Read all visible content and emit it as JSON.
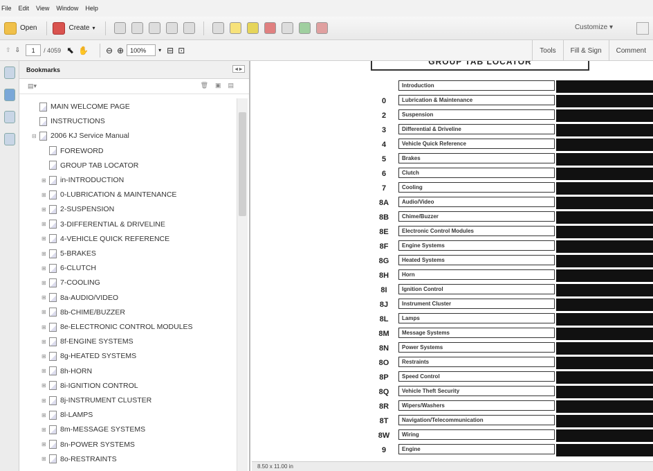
{
  "menu": [
    "File",
    "Edit",
    "View",
    "Window",
    "Help"
  ],
  "toolbar": {
    "open_label": "Open",
    "create_label": "Create",
    "customize_label": "Customize"
  },
  "nav": {
    "page_current": "1",
    "page_total": "/ 4059",
    "zoom": "100%"
  },
  "tabs": [
    "Tools",
    "Fill & Sign",
    "Comment"
  ],
  "bookmarks": {
    "title": "Bookmarks",
    "items": [
      {
        "label": "MAIN WELCOME PAGE",
        "indent": 0,
        "expand": ""
      },
      {
        "label": "INSTRUCTIONS",
        "indent": 0,
        "expand": ""
      },
      {
        "label": "2006 KJ Service Manual",
        "indent": 0,
        "expand": "⊟"
      },
      {
        "label": "FOREWORD",
        "indent": 1,
        "expand": ""
      },
      {
        "label": "GROUP TAB LOCATOR",
        "indent": 1,
        "expand": ""
      },
      {
        "label": "in-INTRODUCTION",
        "indent": 1,
        "expand": "⊞"
      },
      {
        "label": "0-LUBRICATION & MAINTENANCE",
        "indent": 1,
        "expand": "⊞"
      },
      {
        "label": "2-SUSPENSION",
        "indent": 1,
        "expand": "⊞"
      },
      {
        "label": "3-DIFFERENTIAL & DRIVELINE",
        "indent": 1,
        "expand": "⊞"
      },
      {
        "label": "4-VEHICLE QUICK REFERENCE",
        "indent": 1,
        "expand": "⊞"
      },
      {
        "label": "5-BRAKES",
        "indent": 1,
        "expand": "⊞"
      },
      {
        "label": "6-CLUTCH",
        "indent": 1,
        "expand": "⊞"
      },
      {
        "label": "7-COOLING",
        "indent": 1,
        "expand": "⊞"
      },
      {
        "label": "8a-AUDIO/VIDEO",
        "indent": 1,
        "expand": "⊞"
      },
      {
        "label": "8b-CHIME/BUZZER",
        "indent": 1,
        "expand": "⊞"
      },
      {
        "label": "8e-ELECTRONIC CONTROL MODULES",
        "indent": 1,
        "expand": "⊞"
      },
      {
        "label": "8f-ENGINE SYSTEMS",
        "indent": 1,
        "expand": "⊞"
      },
      {
        "label": "8g-HEATED SYSTEMS",
        "indent": 1,
        "expand": "⊞"
      },
      {
        "label": "8h-HORN",
        "indent": 1,
        "expand": "⊞"
      },
      {
        "label": "8i-IGNITION CONTROL",
        "indent": 1,
        "expand": "⊞"
      },
      {
        "label": "8j-INSTRUMENT CLUSTER",
        "indent": 1,
        "expand": "⊞"
      },
      {
        "label": "8l-LAMPS",
        "indent": 1,
        "expand": "⊞"
      },
      {
        "label": "8m-MESSAGE SYSTEMS",
        "indent": 1,
        "expand": "⊞"
      },
      {
        "label": "8n-POWER SYSTEMS",
        "indent": 1,
        "expand": "⊞"
      },
      {
        "label": "8o-RESTRAINTS",
        "indent": 1,
        "expand": "⊞"
      }
    ]
  },
  "document": {
    "header": "GROUP TAB LOCATOR",
    "rows": [
      {
        "code": "",
        "label": "Introduction"
      },
      {
        "code": "0",
        "label": "Lubrication & Maintenance"
      },
      {
        "code": "2",
        "label": "Suspension"
      },
      {
        "code": "3",
        "label": "Differential & Driveline"
      },
      {
        "code": "4",
        "label": "Vehicle Quick Reference"
      },
      {
        "code": "5",
        "label": "Brakes"
      },
      {
        "code": "6",
        "label": "Clutch"
      },
      {
        "code": "7",
        "label": "Cooling"
      },
      {
        "code": "8A",
        "label": "Audio/Video"
      },
      {
        "code": "8B",
        "label": "Chime/Buzzer"
      },
      {
        "code": "8E",
        "label": "Electronic Control Modules"
      },
      {
        "code": "8F",
        "label": "Engine Systems"
      },
      {
        "code": "8G",
        "label": "Heated Systems"
      },
      {
        "code": "8H",
        "label": "Horn"
      },
      {
        "code": "8I",
        "label": "Ignition Control"
      },
      {
        "code": "8J",
        "label": "Instrument Cluster"
      },
      {
        "code": "8L",
        "label": "Lamps"
      },
      {
        "code": "8M",
        "label": "Message Systems"
      },
      {
        "code": "8N",
        "label": "Power Systems"
      },
      {
        "code": "8O",
        "label": "Restraints"
      },
      {
        "code": "8P",
        "label": "Speed Control"
      },
      {
        "code": "8Q",
        "label": "Vehicle Theft Security"
      },
      {
        "code": "8R",
        "label": "Wipers/Washers"
      },
      {
        "code": "8T",
        "label": "Navigation/Telecommunication"
      },
      {
        "code": "8W",
        "label": "Wiring"
      },
      {
        "code": "9",
        "label": "Engine"
      }
    ]
  },
  "status": {
    "page_size": "8.50 x 11.00 in"
  }
}
